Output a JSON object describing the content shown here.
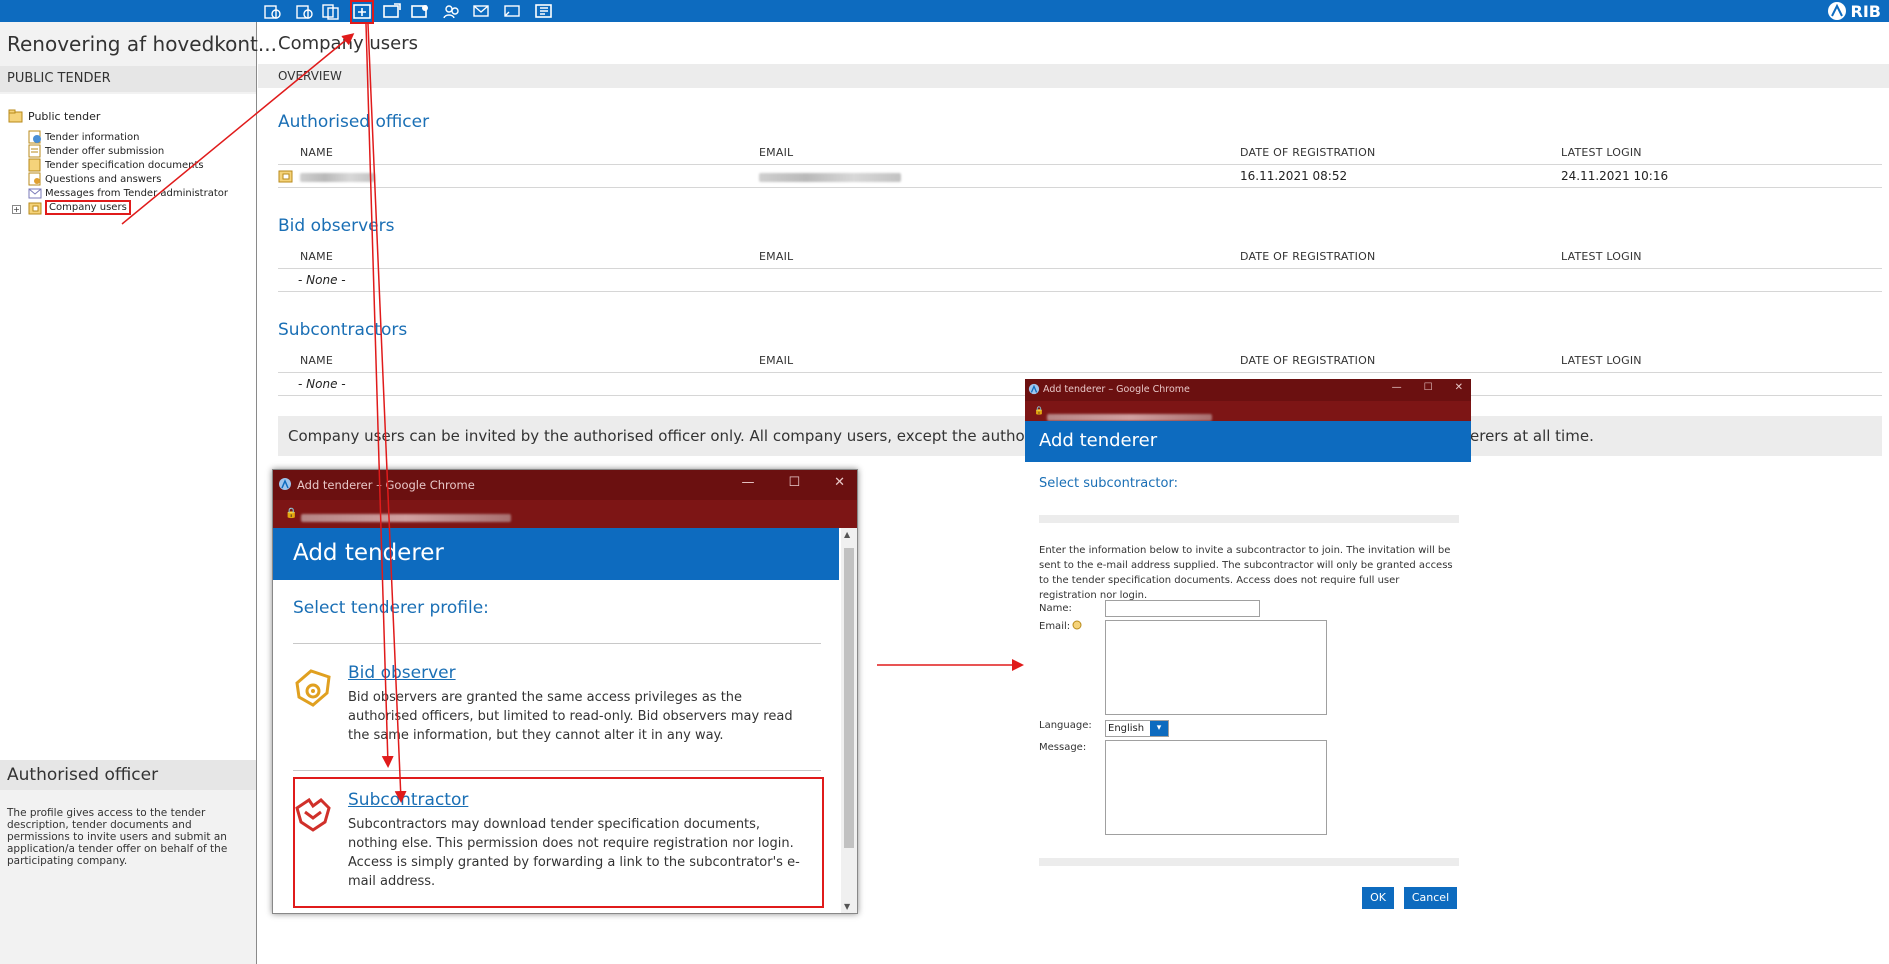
{
  "toolbar": {
    "icons": [
      "tender-icon",
      "documents-icon",
      "documents-copy-icon",
      "company-users-icon",
      "add-user-icon",
      "users-settings-icon",
      "users-group-icon",
      "messages-icon",
      "questions-icon",
      "export-icon"
    ],
    "brand": "RIB"
  },
  "left_panel": {
    "project_title": "Renovering af hovedkont...",
    "section_label": "PUBLIC TENDER",
    "tree_root": "Public tender",
    "tree_items": [
      "Tender information",
      "Tender offer submission",
      "Tender specification documents",
      "Questions and answers",
      "Messages from Tender administrator",
      "Company users"
    ],
    "info_title": "Authorised officer",
    "info_text": "The profile gives access to the tender description, tender documents and permissions to invite users and submit an application/a tender offer on behalf of the participating company."
  },
  "main": {
    "title": "Company users",
    "overview": "OVERVIEW",
    "columns": [
      "NAME",
      "EMAIL",
      "DATE OF REGISTRATION",
      "LATEST LOGIN"
    ],
    "sections": [
      {
        "title": "Authorised officer",
        "rows": [
          {
            "date": "16.11.2021 08:52",
            "login": "24.11.2021 10:16"
          }
        ]
      },
      {
        "title": "Bid observers",
        "empty": "- None -"
      },
      {
        "title": "Subcontractors",
        "empty": "- None -"
      }
    ],
    "info_start": "Company users can be invited by the authorised officer only. All company users, except the authorised of",
    "info_end": "erers at all time."
  },
  "popup1": {
    "window_title": "Add tenderer – Google Chrome",
    "header": "Add tenderer",
    "select_label": "Select tenderer profile:",
    "profiles": [
      {
        "title": "Bid observer",
        "desc": "Bid observers are granted the same access privileges as the authorised officers, but limited to read-only. Bid observers may read the same information, but they cannot alter it in any way."
      },
      {
        "title": "Subcontractor",
        "desc": "Subcontractors may download tender specification documents, nothing else. This permission does not require registration nor login. Access is simply granted by forwarding a link to the subcontrator's e-mail address."
      }
    ]
  },
  "popup2": {
    "window_title": "Add tenderer – Google Chrome",
    "header": "Add tenderer",
    "select_label": "Select subcontractor:",
    "description": "Enter the information below to invite a subcontractor to join. The invitation will be sent to the e-mail address supplied. The subcontractor will only be granted access to the tender specification documents. Access does not require full user registration nor login.",
    "name_label": "Name:",
    "email_label": "Email:",
    "language_label": "Language:",
    "language_value": "English",
    "message_label": "Message:",
    "ok_label": "OK",
    "cancel_label": "Cancel"
  },
  "colors": {
    "accent": "#0d6bbf",
    "chrome_titlebar": "#6b1010",
    "highlight": "#e01b1b"
  }
}
